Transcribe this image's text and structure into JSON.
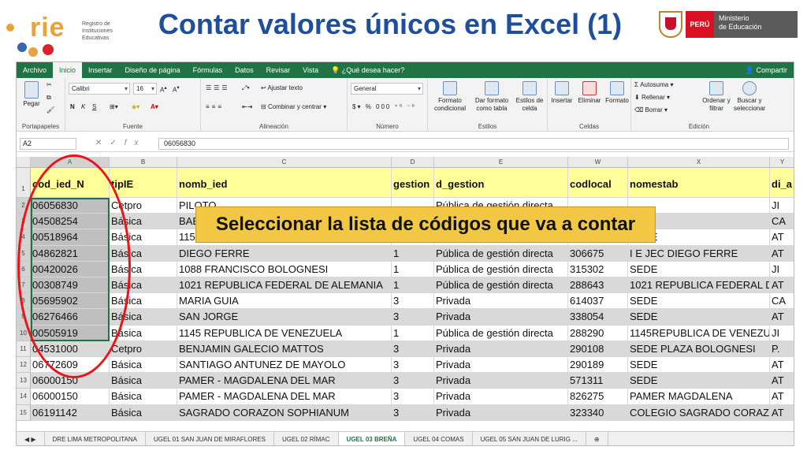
{
  "header": {
    "logo_text": "rie",
    "logo_subtitle": "Registro de\nInstituciones\nEducativas",
    "title": "Contar valores únicos en Excel (1)",
    "peru_label": "PERÚ",
    "ministry_label": "Ministerio\nde Educación"
  },
  "excel": {
    "menu_tabs": [
      "Archivo",
      "Inicio",
      "Insertar",
      "Diseño de página",
      "Fórmulas",
      "Datos",
      "Revisar",
      "Vista",
      "¿Qué desea hacer?"
    ],
    "active_tab": "Inicio",
    "share_label": "Compartir",
    "ribbon": {
      "clipboard": {
        "paste": "Pegar",
        "label": "Portapapeles"
      },
      "font": {
        "name": "Calibri",
        "size": "16",
        "bold": "N",
        "italic": "K",
        "underline": "S",
        "label": "Fuente"
      },
      "alignment": {
        "wrap": "Ajustar texto",
        "merge": "Combinar y centrar",
        "label": "Alineación"
      },
      "number": {
        "format": "General",
        "label": "Número"
      },
      "styles": {
        "conditional": "Formato condicional",
        "table": "Dar formato como tabla",
        "cell": "Estilos de celda",
        "label": "Estilos"
      },
      "cells": {
        "insert": "Insertar",
        "delete": "Eliminar",
        "format": "Formato",
        "label": "Celdas"
      },
      "editing": {
        "autosum": "Autosuma",
        "fill": "Rellenar",
        "clear": "Borrar",
        "sort": "Ordenar y filtrar",
        "find": "Buscar y seleccionar",
        "label": "Edición"
      }
    },
    "name_box": "A2",
    "formula_value": "06056830",
    "columns": [
      "A",
      "B",
      "C",
      "D",
      "E",
      "W",
      "X",
      "Y"
    ],
    "header_row": [
      "cod_ied_N",
      "tipIE",
      "nomb_ied",
      "gestion",
      "d_gestion",
      "codlocal",
      "nomestab",
      "di_a"
    ],
    "rows": [
      {
        "n": "2",
        "cells": [
          "06056830",
          "Cetpro",
          "PILOTO",
          "",
          "Pública de gestión directa",
          "",
          "",
          "JI"
        ]
      },
      {
        "n": "3",
        "cells": [
          "04508254",
          "Básica",
          "BAE",
          "",
          "",
          "",
          "GYM",
          "CA"
        ]
      },
      {
        "n": "4",
        "cells": [
          "00518964",
          "Básica",
          "1157 JULIO CESAR TELLO ROJAS",
          "1",
          "Pública de gestión directa",
          "288365",
          "SEDE",
          "AT"
        ]
      },
      {
        "n": "5",
        "cells": [
          "04862821",
          "Básica",
          "DIEGO FERRE",
          "1",
          "Pública de gestión directa",
          "306675",
          "I E JEC DIEGO FERRE",
          "AT"
        ]
      },
      {
        "n": "6",
        "cells": [
          "00420026",
          "Básica",
          "1088 FRANCISCO BOLOGNESI",
          "1",
          "Pública de gestión directa",
          "315302",
          "SEDE",
          "JI"
        ]
      },
      {
        "n": "7",
        "cells": [
          "00308749",
          "Básica",
          "1021 REPUBLICA FEDERAL DE ALEMANIA",
          "1",
          "Pública de gestión directa",
          "288643",
          "1021 REPUBLICA FEDERAL DE A",
          "AT"
        ]
      },
      {
        "n": "8",
        "cells": [
          "05695902",
          "Básica",
          "MARIA GUIA",
          "3",
          "Privada",
          "614037",
          "SEDE",
          "CA"
        ]
      },
      {
        "n": "9",
        "cells": [
          "06276466",
          "Básica",
          "SAN JORGE",
          "3",
          "Privada",
          "338054",
          "SEDE",
          "AT"
        ]
      },
      {
        "n": "10",
        "cells": [
          "00505919",
          "Básica",
          "1145 REPUBLICA DE VENEZUELA",
          "1",
          "Pública de gestión directa",
          "288290",
          "1145REPUBLICA DE VENEZUE",
          "JI"
        ]
      },
      {
        "n": "11",
        "cells": [
          "04531000",
          "Cetpro",
          "BENJAMIN GALECIO MATTOS",
          "3",
          "Privada",
          "290108",
          "SEDE PLAZA BOLOGNESI",
          "P."
        ]
      },
      {
        "n": "12",
        "cells": [
          "06772609",
          "Básica",
          "SANTIAGO ANTUNEZ DE MAYOLO",
          "3",
          "Privada",
          "290189",
          "SEDE",
          "AT"
        ]
      },
      {
        "n": "13",
        "cells": [
          "06000150",
          "Básica",
          "PAMER - MAGDALENA DEL MAR",
          "3",
          "Privada",
          "571311",
          "SEDE",
          "AT"
        ]
      },
      {
        "n": "14",
        "cells": [
          "06000150",
          "Básica",
          "PAMER - MAGDALENA DEL MAR",
          "3",
          "Privada",
          "826275",
          "PAMER MAGDALENA",
          "AT"
        ]
      },
      {
        "n": "15",
        "cells": [
          "06191142",
          "Básica",
          "SAGRADO CORAZON SOPHIANUM",
          "3",
          "Privada",
          "323340",
          "COLEGIO SAGRADO CORAZÓ",
          "AT"
        ]
      }
    ],
    "sheet_tabs": [
      "DRE LIMA METROPOLITANA",
      "UGEL 01 SAN JUAN DE MIRAFLORES",
      "UGEL 02 RÍMAC",
      "UGEL 03 BREÑA",
      "UGEL 04 COMAS",
      "UGEL 05 SAN JUAN DE LURIG ..."
    ],
    "active_sheet": "UGEL 03 BREÑA"
  },
  "callout": "Seleccionar la lista de códigos que va a contar",
  "colors": {
    "excel_green": "#217346",
    "title_blue": "#1f4e9a",
    "callout_yellow": "#f2c744",
    "highlight_red": "#e8141a",
    "header_yellow": "#ffff99"
  }
}
